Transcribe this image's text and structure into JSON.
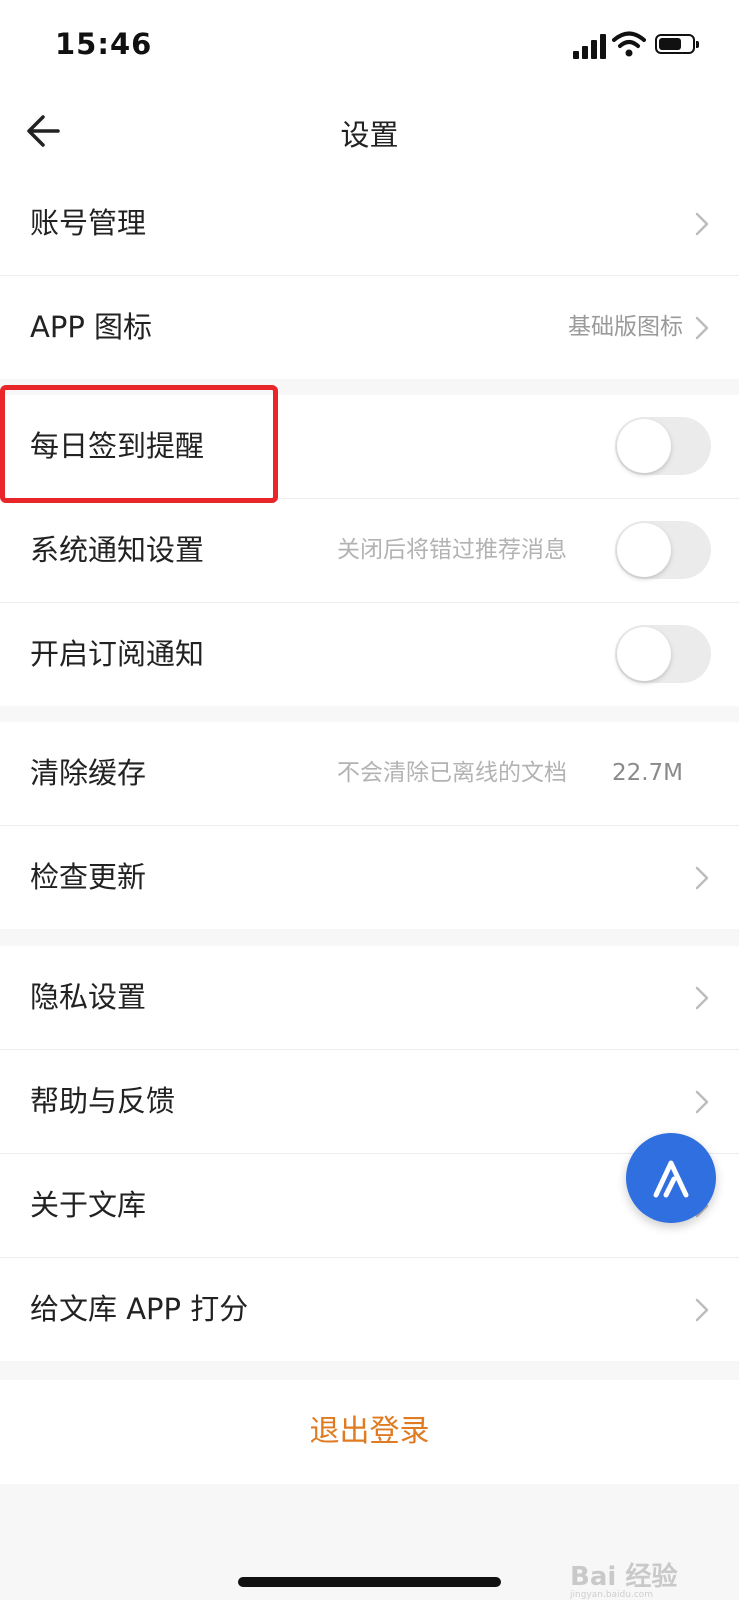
{
  "status_bar": {
    "time": "15:46"
  },
  "nav": {
    "title": "设置"
  },
  "groups": [
    {
      "items": [
        {
          "label": "账号管理"
        },
        {
          "label": "APP 图标",
          "value": "基础版图标"
        }
      ]
    },
    {
      "items": [
        {
          "label": "每日签到提醒",
          "toggle": false
        },
        {
          "label": "系统通知设置",
          "hint": "关闭后将错过推荐消息",
          "toggle": false
        },
        {
          "label": "开启订阅通知",
          "toggle": false
        }
      ]
    },
    {
      "items": [
        {
          "label": "清除缓存",
          "hint": "不会清除已离线的文档",
          "value": "22.7M"
        },
        {
          "label": "检查更新"
        }
      ]
    },
    {
      "items": [
        {
          "label": "隐私设置"
        },
        {
          "label": "帮助与反馈"
        },
        {
          "label": "关于文库"
        },
        {
          "label": "给文库 APP 打分"
        }
      ]
    }
  ],
  "logout": {
    "label": "退出登录"
  },
  "watermark": {
    "text": "Bai 经验",
    "sub": "jingyan.baidu.com"
  },
  "colors": {
    "accent": "#e07b22",
    "highlight": "#e8262a",
    "fab": "#2f6fe0"
  }
}
